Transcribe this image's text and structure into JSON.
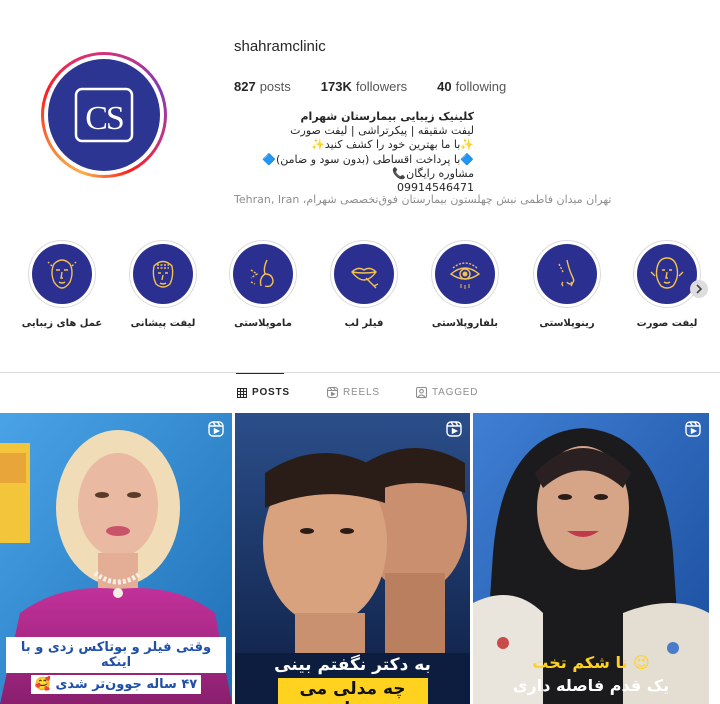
{
  "profile": {
    "username": "shahramclinic",
    "avatar_text": "CS",
    "stats": {
      "posts_count": "827",
      "posts_label": "posts",
      "followers_count": "173K",
      "followers_label": "followers",
      "following_count": "40",
      "following_label": "following"
    },
    "bio": {
      "name": "کلینیک زیبایی بیمارستان شهرام",
      "line1": "لیفت شقیقه | پیکرتراشی | لیفت صورت",
      "line2": "✨با ما بهترین خود را کشف کنید✨",
      "line3": "🔷با پرداخت اقساطی (بدون سود و ضامن)🔷",
      "line4": "مشاوره رایگان📞",
      "phone": "09914546471",
      "address_fa": "تهران میدان فاطمی نبش چهلستون بیمارستان فوق‌تخصصی شهرام،",
      "address_en": "Tehran, Iran"
    }
  },
  "highlights": [
    {
      "label": "عمل های زیبایی",
      "icon": "face-outline-icon"
    },
    {
      "label": "لیفت پیشانی",
      "icon": "forehead-lift-icon"
    },
    {
      "label": "ماموپلاستی",
      "icon": "mammoplasty-icon"
    },
    {
      "label": "فیلر لب",
      "icon": "lip-filler-icon"
    },
    {
      "label": "بلفاروپلاستی",
      "icon": "eye-icon"
    },
    {
      "label": "رینوپلاستی",
      "icon": "nose-icon"
    },
    {
      "label": "لیفت صورت",
      "icon": "face-lift-icon"
    }
  ],
  "tabs": {
    "posts": "POSTS",
    "reels": "REELS",
    "tagged": "TAGGED"
  },
  "posts": [
    {
      "caption_line1": "وقتی فیلر و بوتاکس زدی و با اینکه",
      "caption_line2": "۴۷ ساله جوون‌تر شدی 🥰",
      "type": "reel"
    },
    {
      "caption_line1": "به دکتر نگفتم بینی",
      "caption_line2": "چه مدلی می خوام",
      "type": "reel"
    },
    {
      "caption_line1": "😉 تا شکم تخت",
      "caption_line2": "یک قدم فاصله داری",
      "type": "reel"
    }
  ],
  "colors": {
    "brand_navy": "#2b2f8f",
    "text": "#262626",
    "muted": "#8e8e8e",
    "border": "#dbdbdb",
    "caption_yellow": "#ffd21f"
  }
}
